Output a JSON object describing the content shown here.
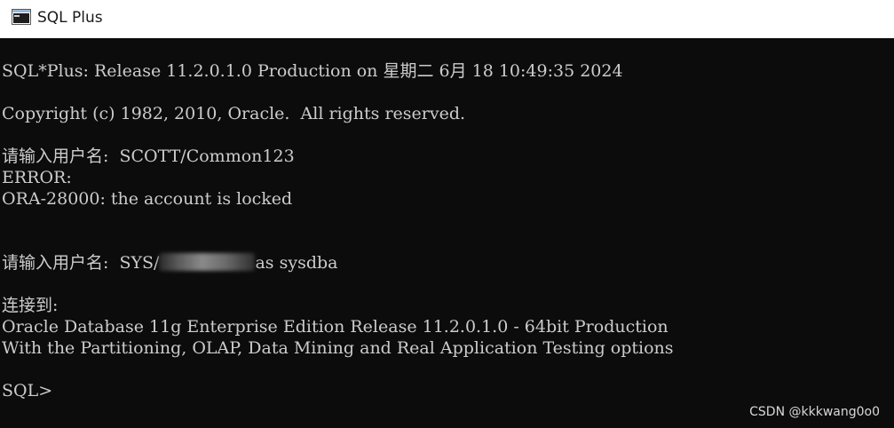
{
  "window": {
    "title": "SQL Plus",
    "icon": "console-app-icon"
  },
  "console": {
    "lines": [
      "SQL*Plus: Release 11.2.0.1.0 Production on 星期二 6月 18 10:49:35 2024",
      "Copyright (c) 1982, 2010, Oracle.  All rights reserved.",
      "请输入用户名:  SCOTT/Common123",
      "ERROR:",
      "ORA-28000: the account is locked",
      "连接到:",
      "Oracle Database 11g Enterprise Edition Release 11.2.0.1.0 - 64bit Production",
      "With the Partitioning, OLAP, Data Mining and Real Application Testing options",
      "SQL>"
    ],
    "login_prompt": "请输入用户名:  SYS/",
    "login_suffix": "as sysdba"
  },
  "watermark": "CSDN @kkkwang0o0"
}
